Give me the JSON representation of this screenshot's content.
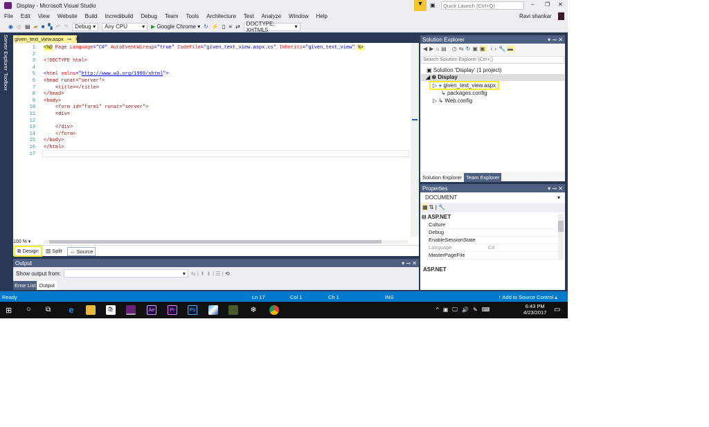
{
  "window": {
    "title": "Display - Microsoft Visual Studio",
    "quick_launch_placeholder": "Quick Launch (Ctrl+Q)",
    "user": "Ravi shankar"
  },
  "menu": [
    "File",
    "Edit",
    "View",
    "Website",
    "Build",
    "Incredibuild",
    "Debug",
    "Team",
    "Tools",
    "Architecture",
    "Test",
    "Analyze",
    "Window",
    "Help"
  ],
  "toolbar": {
    "config": "Debug",
    "platform": "Any CPU",
    "run_target": "Google Chrome",
    "doctype": "DOCTYPE: XHTML5"
  },
  "side_tabs": [
    "Server Explorer",
    "Toolbox"
  ],
  "editor": {
    "tab": "given_text_view.aspx",
    "zoom": "100 %",
    "views": [
      "Design",
      "Split",
      "Source"
    ],
    "lines": [
      "1",
      "2",
      "3",
      "4",
      "5",
      "6",
      "7",
      "8",
      "9",
      "10",
      "11",
      "12",
      "13",
      "14",
      "15",
      "16",
      "17"
    ],
    "code": {
      "l1a": "<%@",
      "l1b": " Page ",
      "l1c": "Language",
      "l1d": "=\"C#\" ",
      "l1e": "AutoEventWireup",
      "l1f": "=\"true\" ",
      "l1g": "CodeFile",
      "l1h": "=\"given_text_view.aspx.cs\" ",
      "l1i": "Inherits",
      "l1j": "=\"given_text_view\" ",
      "l1k": "%>",
      "l3": "<!DOCTYPE html>",
      "l5a": "<",
      "l5b": "html ",
      "l5c": "xmlns",
      "l5d": "=\"",
      "l5e": "http://www.w3.org/1999/xhtml",
      "l5f": "\">",
      "l6": "<head runat=\"server\">",
      "l7": "<title></title>",
      "l8": "</head>",
      "l9": "<body>",
      "l10": "<form id=\"form1\" runat=\"server\">",
      "l11": "<div>",
      "l13": "</div>",
      "l14": "</form>",
      "l15": "</body>",
      "l16": "</html>"
    }
  },
  "output": {
    "title": "Output",
    "show_from_label": "Show output from:",
    "tabs": [
      "Error List",
      "Output"
    ]
  },
  "solution_explorer": {
    "title": "Solution Explorer",
    "search_placeholder": "Search Solution Explorer (Ctrl+;)",
    "solution": "Solution 'Display' (1 project)",
    "project": "Display",
    "items": [
      "given_text_view.aspx",
      "packages.config",
      "Web.config"
    ],
    "tabs": [
      "Solution Explorer",
      "Team Explorer"
    ]
  },
  "properties": {
    "title": "Properties",
    "object": "DOCUMENT",
    "category": "ASP.NET",
    "rows": [
      {
        "name": "Culture",
        "value": ""
      },
      {
        "name": "Debug",
        "value": ""
      },
      {
        "name": "EnableSessionState",
        "value": ""
      },
      {
        "name": "Language",
        "value": "C#"
      },
      {
        "name": "MasterPageFile",
        "value": ""
      }
    ],
    "description": "ASP.NET"
  },
  "status": {
    "ready": "Ready",
    "ln": "Ln 17",
    "col": "Col 1",
    "ch": "Ch 1",
    "mode": "INS",
    "source_control": "Add to Source Control"
  },
  "taskbar": {
    "time": "6:43 PM",
    "date": "4/23/2017",
    "apps": [
      "Ae",
      "Pr",
      "Ps"
    ]
  }
}
